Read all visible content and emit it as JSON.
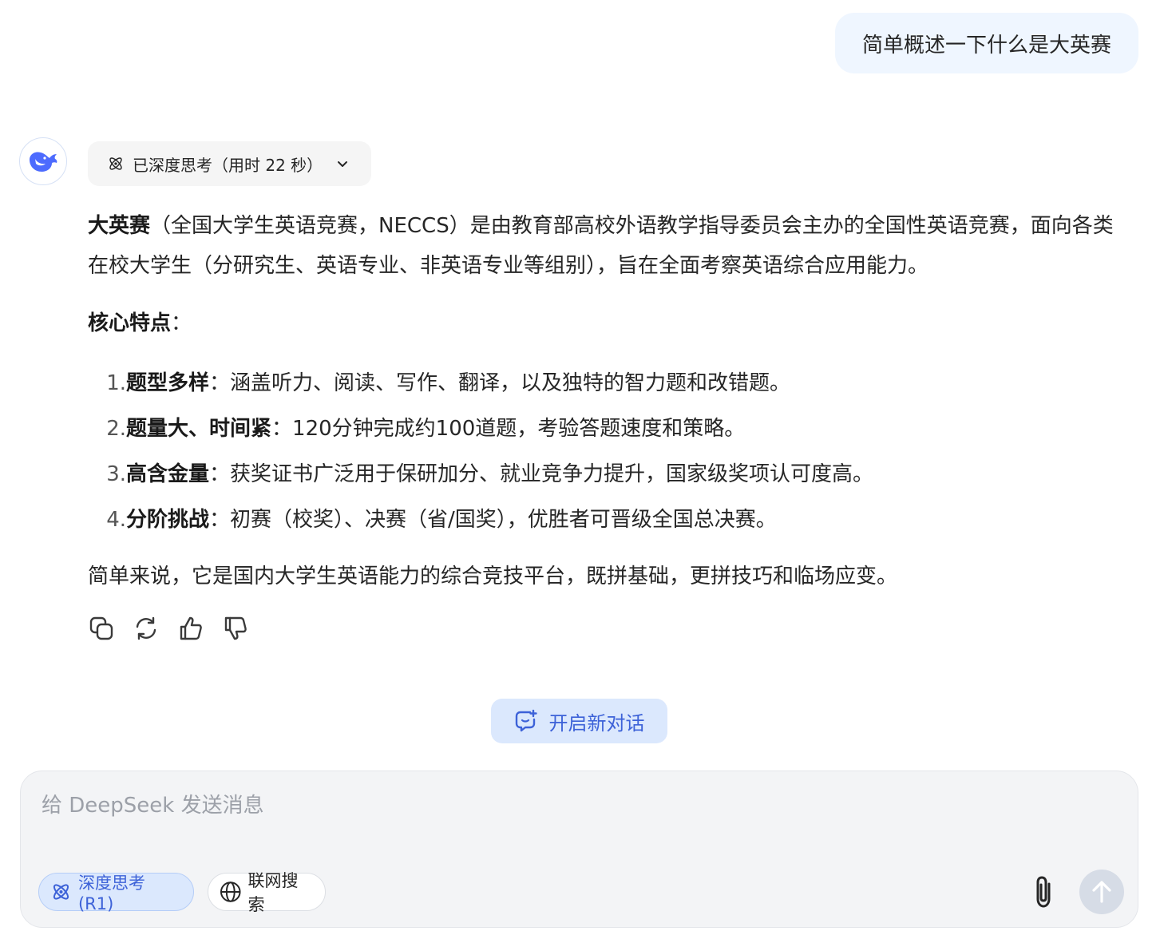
{
  "user_message": "简单概述一下什么是大英赛",
  "thinking": {
    "label": "已深度思考（用时 22 秒）"
  },
  "answer": {
    "intro_bold": "大英赛",
    "intro_rest": "（全国大学生英语竞赛，NECCS）是由教育部高校外语教学指导委员会主办的全国性英语竞赛，面向各类在校大学生（分研究生、英语专业、非英语专业等组别），旨在全面考察英语综合应用能力。",
    "features_heading": "核心特点",
    "features_colon": "：",
    "features": [
      {
        "num": "1.",
        "title": "题型多样",
        "sep": "：",
        "text": "涵盖听力、阅读、写作、翻译，以及独特的智力题和改错题。"
      },
      {
        "num": "2.",
        "title": "题量大、时间紧",
        "sep": "：",
        "text": "120分钟完成约100道题，考验答题速度和策略。"
      },
      {
        "num": "3.",
        "title": "高含金量",
        "sep": "：",
        "text": "获奖证书广泛用于保研加分、就业竞争力提升，国家级奖项认可度高。"
      },
      {
        "num": "4.",
        "title": "分阶挑战",
        "sep": "：",
        "text": "初赛（校奖）、决赛（省/国奖），优胜者可晋级全国总决赛。"
      }
    ],
    "summary": "简单来说，它是国内大学生英语能力的综合竞技平台，既拼基础，更拼技巧和临场应变。"
  },
  "actions": {
    "icons": [
      "copy-icon",
      "regenerate-icon",
      "thumbs-up-icon",
      "thumbs-down-icon"
    ]
  },
  "new_chat": {
    "label": "开启新对话"
  },
  "composer": {
    "placeholder": "给 DeepSeek 发送消息",
    "value": "",
    "deep_think_label": "深度思考 (R1)",
    "web_search_label": "联网搜索"
  },
  "colors": {
    "accent": "#3d62d8",
    "accent_bg": "#dbe8fd",
    "user_bubble_bg": "#eff6ff",
    "composer_bg": "#f3f4f6"
  }
}
